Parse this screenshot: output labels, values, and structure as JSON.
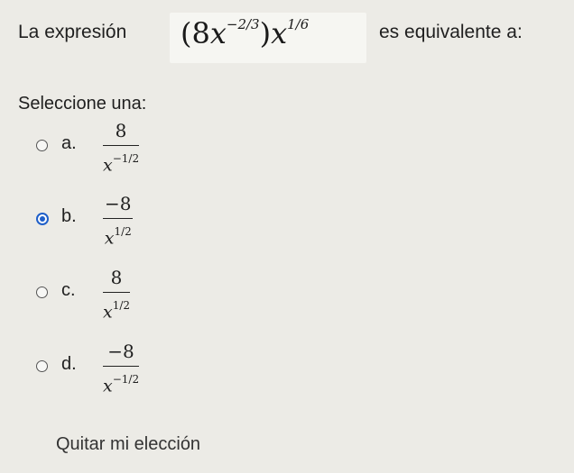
{
  "question": {
    "prefix": "La expresión",
    "suffix": "es equivalente a:",
    "expression": {
      "open": "(8",
      "var1": "x",
      "exp1": "−2/3",
      "close": ")",
      "var2": "x",
      "exp2": "1/6"
    }
  },
  "prompt": "Seleccione una:",
  "options": [
    {
      "letter": "a.",
      "numerator": "8",
      "den_var": "x",
      "den_exp": "−1/2",
      "selected": false
    },
    {
      "letter": "b.",
      "numerator": "−8",
      "den_var": "x",
      "den_exp": "1/2",
      "selected": true
    },
    {
      "letter": "c.",
      "numerator": "8",
      "den_var": "x",
      "den_exp": "1/2",
      "selected": false
    },
    {
      "letter": "d.",
      "numerator": "−8",
      "den_var": "x",
      "den_exp": "−1/2",
      "selected": false
    }
  ],
  "clear_label": "Quitar mi elección",
  "colors": {
    "background": "#ecebe6",
    "radio_selected": "#1f5fc9"
  }
}
